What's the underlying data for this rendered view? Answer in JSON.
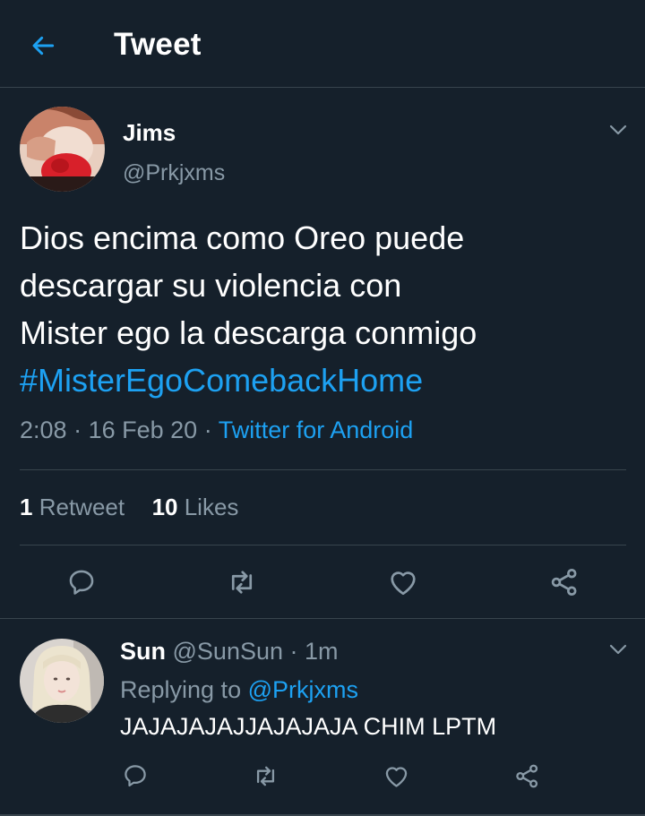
{
  "header": {
    "title": "Tweet",
    "back_icon": "arrow-left-icon",
    "accent": "#1da1f2"
  },
  "tweet": {
    "author_name": "Jims",
    "author_handle": "@Prkjxms",
    "text_lines": [
      "Dios encima como Oreo puede",
      "descargar su violencia con",
      "Mister ego la descarga conmigo"
    ],
    "hashtag": "#MisterEgoComebackHome",
    "time": "2:08",
    "date": "16 Feb 20",
    "source": "Twitter for Android",
    "retweets_count": "1",
    "retweets_label": "Retweet",
    "likes_count": "10",
    "likes_label": "Likes",
    "actions": [
      "reply-icon",
      "retweet-icon",
      "like-icon",
      "share-icon"
    ]
  },
  "reply": {
    "author_name": "Sun",
    "author_handle": "@SunSun",
    "time": "1m",
    "replying_prefix": "Replying to",
    "replying_to": "@Prkjxms",
    "text": "JAJAJAJAJJAJAJAJA CHIM LPTM"
  },
  "colors": {
    "background": "#15202b",
    "divider": "#38444d",
    "secondary_text": "#8899a6",
    "link": "#1da1f2"
  }
}
